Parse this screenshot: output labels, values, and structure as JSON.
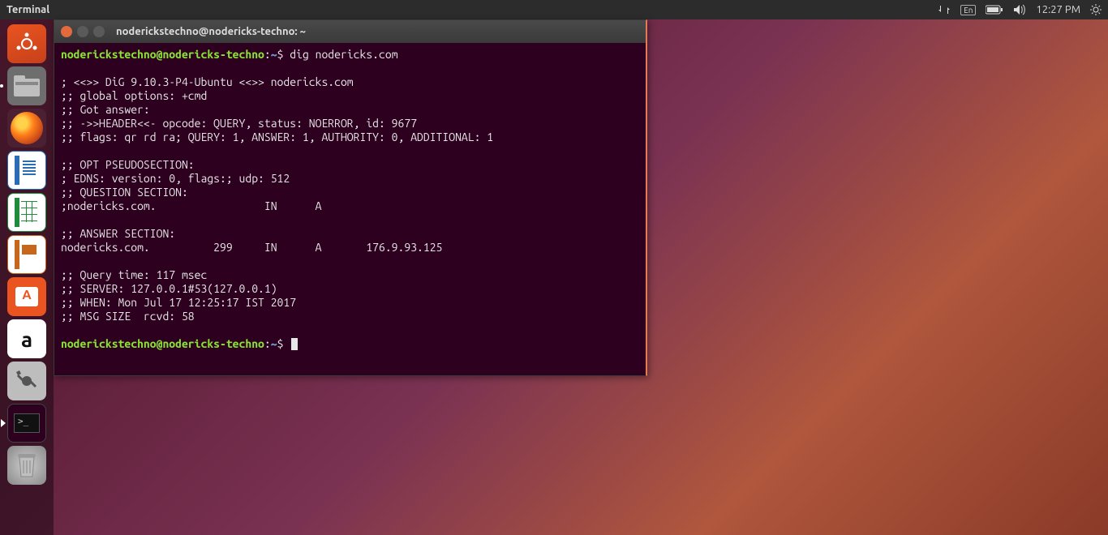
{
  "menubar": {
    "title": "Terminal",
    "lang": "En",
    "time": "12:27 PM"
  },
  "launcher": {
    "items": [
      {
        "name": "dash",
        "label": "Dash"
      },
      {
        "name": "files",
        "label": "Files"
      },
      {
        "name": "firefox",
        "label": "Firefox"
      },
      {
        "name": "writer",
        "label": "LibreOffice Writer"
      },
      {
        "name": "calc",
        "label": "LibreOffice Calc"
      },
      {
        "name": "impress",
        "label": "LibreOffice Impress"
      },
      {
        "name": "software",
        "label": "Ubuntu Software"
      },
      {
        "name": "amazon",
        "label": "Amazon"
      },
      {
        "name": "settings",
        "label": "System Settings"
      },
      {
        "name": "terminal",
        "label": "Terminal"
      },
      {
        "name": "trash",
        "label": "Trash"
      }
    ]
  },
  "terminal": {
    "title": "noderickstechno@nodericks-techno: ~",
    "prompt": {
      "user_host": "noderickstechno@nodericks-techno",
      "path": "~",
      "sep": ":",
      "symbol": "$"
    },
    "command": "dig nodericks.com",
    "output_lines": [
      "",
      "; <<>> DiG 9.10.3-P4-Ubuntu <<>> nodericks.com",
      ";; global options: +cmd",
      ";; Got answer:",
      ";; ->>HEADER<<- opcode: QUERY, status: NOERROR, id: 9677",
      ";; flags: qr rd ra; QUERY: 1, ANSWER: 1, AUTHORITY: 0, ADDITIONAL: 1",
      "",
      ";; OPT PSEUDOSECTION:",
      "; EDNS: version: 0, flags:; udp: 512",
      ";; QUESTION SECTION:",
      ";nodericks.com.                 IN      A",
      "",
      ";; ANSWER SECTION:",
      "nodericks.com.          299     IN      A       176.9.93.125",
      "",
      ";; Query time: 117 msec",
      ";; SERVER: 127.0.0.1#53(127.0.0.1)",
      ";; WHEN: Mon Jul 17 12:25:17 IST 2017",
      ";; MSG SIZE  rcvd: 58",
      ""
    ]
  }
}
